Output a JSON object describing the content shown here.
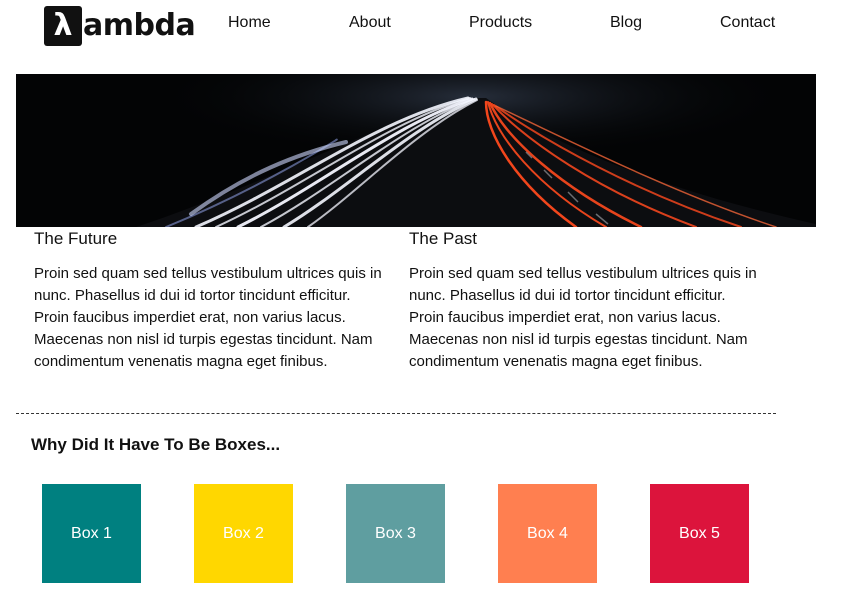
{
  "header": {
    "logo_mark": "λ",
    "logo_text": "ambda",
    "nav": [
      "Home",
      "About",
      "Products",
      "Blog",
      "Contact"
    ]
  },
  "hero": {
    "colors": {
      "background": "#030405",
      "light_trail_white": "#f4f6ff",
      "light_trail_red": "#ff4a1e"
    }
  },
  "columns": [
    {
      "title": "The Future",
      "body": "Proin sed quam sed tellus vestibulum ultrices quis in nunc. Phasellus id dui id tortor tincidunt efficitur. Proin faucibus imperdiet erat, non varius lacus. Maecenas non nisl id turpis egestas tincidunt. Nam condimentum venenatis magna eget finibus."
    },
    {
      "title": "The Past",
      "body": "Proin sed quam sed tellus vestibulum ultrices quis in nunc. Phasellus id dui id tortor tincidunt efficitur. Proin faucibus imperdiet erat, non varius lacus. Maecenas non nisl id turpis egestas tincidunt. Nam condimentum venenatis magna eget finibus."
    }
  ],
  "boxes_section": {
    "title": "Why Did It Have To Be Boxes...",
    "boxes": [
      {
        "label": "Box 1",
        "color": "#008080"
      },
      {
        "label": "Box 2",
        "color": "#ffd700"
      },
      {
        "label": "Box 3",
        "color": "#5f9ea0"
      },
      {
        "label": "Box 4",
        "color": "#ff7f50"
      },
      {
        "label": "Box 5",
        "color": "#dc143c"
      }
    ]
  }
}
